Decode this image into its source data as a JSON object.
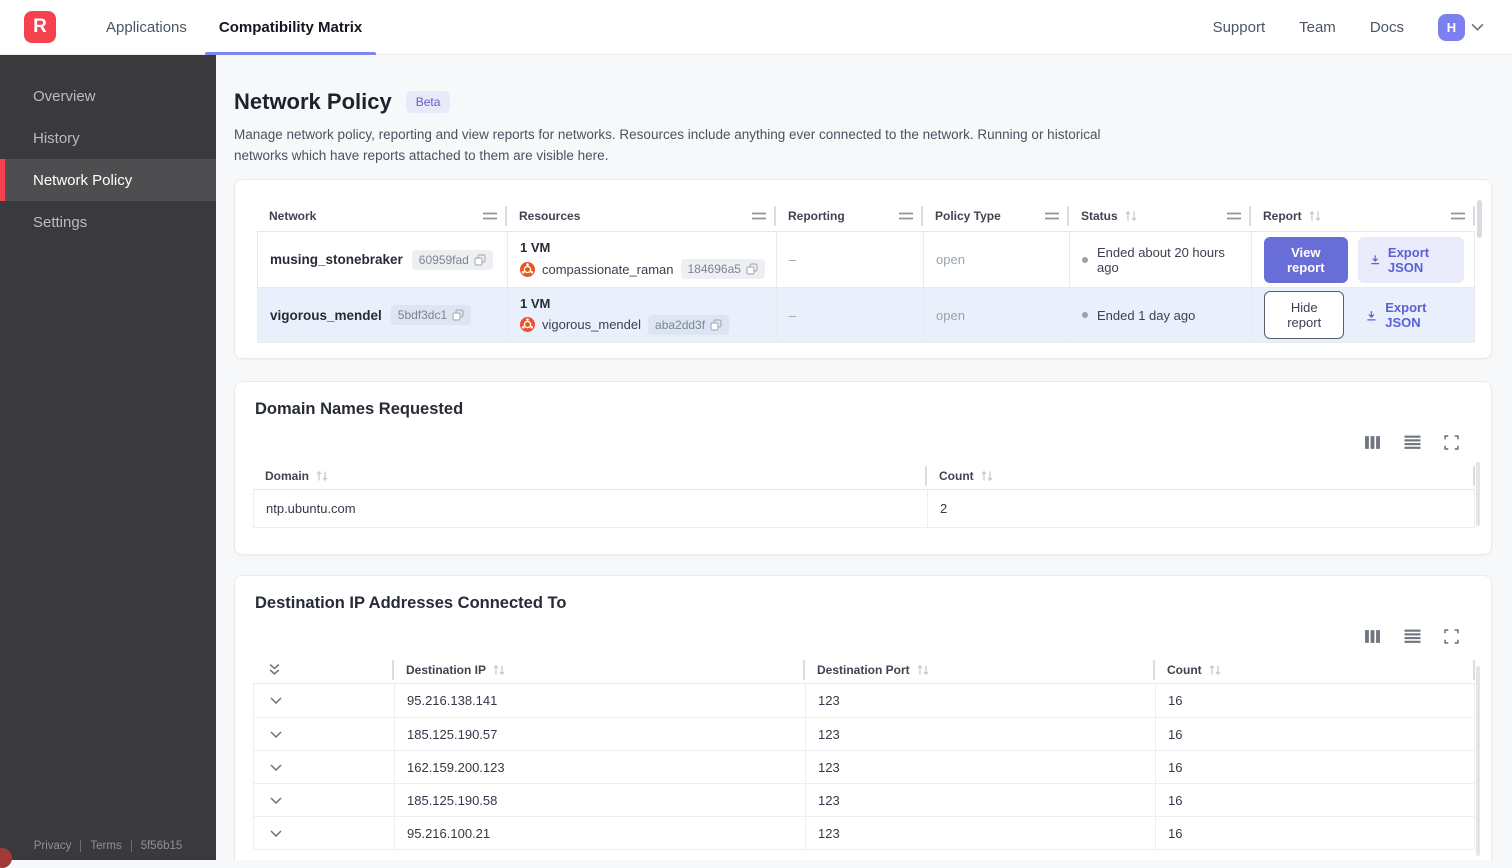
{
  "topnav": {
    "logo_letter": "R",
    "tab_applications": "Applications",
    "tab_compatibility": "Compatibility Matrix",
    "link_support": "Support",
    "link_team": "Team",
    "link_docs": "Docs",
    "avatar_initial": "H"
  },
  "sidebar": {
    "item_overview": "Overview",
    "item_history": "History",
    "item_network_policy": "Network Policy",
    "item_settings": "Settings",
    "footer_privacy": "Privacy",
    "footer_terms": "Terms",
    "footer_build": "5f56b15"
  },
  "page": {
    "title": "Network Policy",
    "beta_badge": "Beta",
    "description": "Manage network policy, reporting and view reports for networks. Resources include anything ever connected to the network. Running or historical networks which have reports attached to them are visible here."
  },
  "networks_table": {
    "col_network": "Network",
    "col_resources": "Resources",
    "col_reporting": "Reporting",
    "col_policy_type": "Policy Type",
    "col_status": "Status",
    "col_report": "Report",
    "rows": [
      {
        "name": "musing_stonebraker",
        "id": "60959fad",
        "vm_count": "1 VM",
        "resource_name": "compassionate_raman",
        "resource_id": "184696a5",
        "reporting": "–",
        "policy_type": "open",
        "status": "Ended about 20 hours ago",
        "report_action": "View report",
        "export_label": "Export JSON"
      },
      {
        "name": "vigorous_mendel",
        "id": "5bdf3dc1",
        "vm_count": "1 VM",
        "resource_name": "vigorous_mendel",
        "resource_id": "aba2dd3f",
        "reporting": "–",
        "policy_type": "open",
        "status": "Ended 1 day ago",
        "report_action": "Hide report",
        "export_label": "Export JSON"
      }
    ]
  },
  "domains_card": {
    "title": "Domain Names Requested",
    "col_domain": "Domain",
    "col_count": "Count",
    "rows": [
      {
        "domain": "ntp.ubuntu.com",
        "count": "2"
      }
    ]
  },
  "destinations_card": {
    "title": "Destination IP Addresses Connected To",
    "col_ip": "Destination IP",
    "col_port": "Destination Port",
    "col_count": "Count",
    "rows": [
      {
        "ip": "95.216.138.141",
        "port": "123",
        "count": "16"
      },
      {
        "ip": "185.125.190.57",
        "port": "123",
        "count": "16"
      },
      {
        "ip": "162.159.200.123",
        "port": "123",
        "count": "16"
      },
      {
        "ip": "185.125.190.58",
        "port": "123",
        "count": "16"
      },
      {
        "ip": "95.216.100.21",
        "port": "123",
        "count": "16"
      }
    ]
  },
  "colors": {
    "brand_red": "#f5424e",
    "accent_indigo": "#686dd8",
    "selected_row": "#e9effb",
    "sidebar_bg": "#3a3a3c"
  }
}
